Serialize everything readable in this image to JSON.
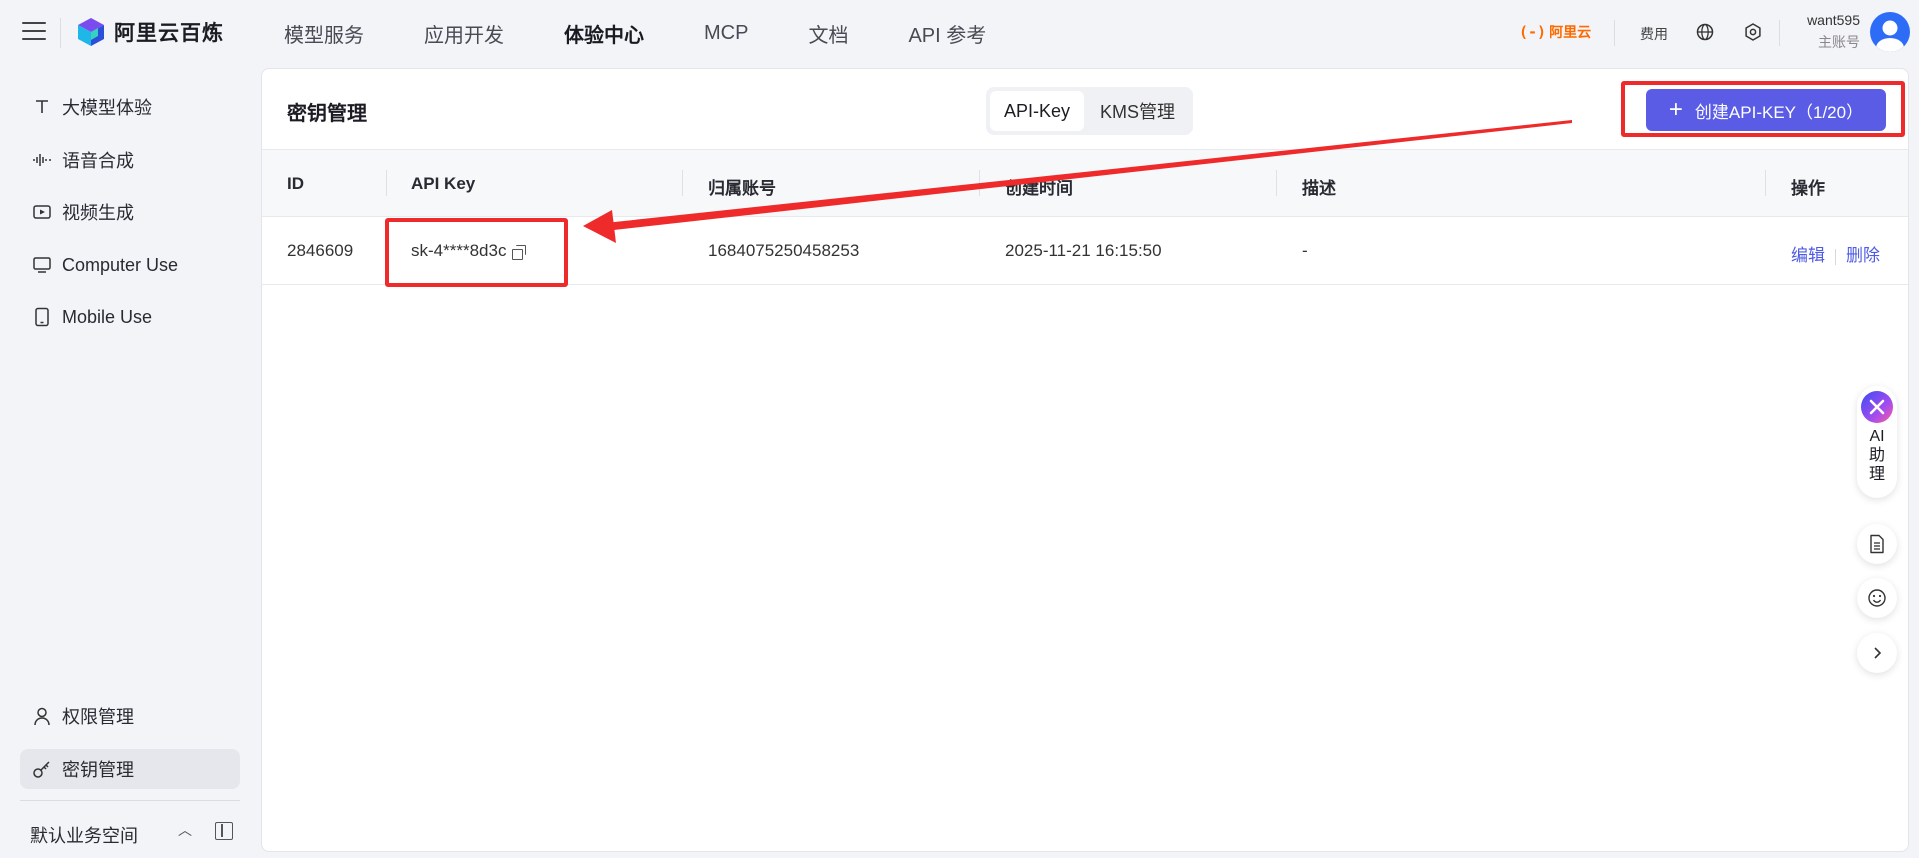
{
  "app": {
    "name": "阿里云百炼"
  },
  "nav": {
    "items": [
      {
        "label": "模型服务"
      },
      {
        "label": "应用开发"
      },
      {
        "label": "体验中心"
      },
      {
        "label": "MCP"
      },
      {
        "label": "文档"
      },
      {
        "label": "API 参考"
      }
    ],
    "active": "体验中心"
  },
  "header": {
    "aliyun_mark": "(-)",
    "aliyun_label": "阿里云",
    "fee_label": "费用",
    "user_name": "want595",
    "user_role": "主账号"
  },
  "sidebar": {
    "top_items": [
      {
        "label": "大模型体验",
        "icon": "text-icon"
      },
      {
        "label": "语音合成",
        "icon": "waveform-icon"
      },
      {
        "label": "视频生成",
        "icon": "video-icon"
      },
      {
        "label": "Computer Use",
        "icon": "monitor-icon"
      },
      {
        "label": "Mobile Use",
        "icon": "phone-icon"
      }
    ],
    "bottom_items": [
      {
        "label": "权限管理",
        "icon": "user-icon"
      },
      {
        "label": "密钥管理",
        "icon": "key-icon",
        "active": true
      }
    ],
    "workspace": "默认业务空间",
    "workspace_chevron": "︿"
  },
  "panel": {
    "title": "密钥管理",
    "tabs": [
      {
        "label": "API-Key",
        "active": true
      },
      {
        "label": "KMS管理",
        "active": false
      }
    ],
    "create_button": {
      "plus": "+",
      "label": "创建API-KEY（1/20）"
    }
  },
  "table": {
    "columns": [
      "ID",
      "API Key",
      "归属账号",
      "创建时间",
      "描述",
      "操作"
    ],
    "rows": [
      {
        "id": "2846609",
        "api_key": "sk-4****8d3c",
        "account": "1684075250458253",
        "created": "2025-11-21 16:15:50",
        "description": "-",
        "edit": "编辑",
        "delete": "删除"
      }
    ]
  },
  "assistant": {
    "label": "AI助理",
    "chars": [
      "AI",
      "助",
      "理"
    ]
  },
  "colors": {
    "accent": "#5a5ce6",
    "link": "#4e5be4",
    "annotation": "#ee2a2a",
    "aliyun": "#ff6a00"
  }
}
